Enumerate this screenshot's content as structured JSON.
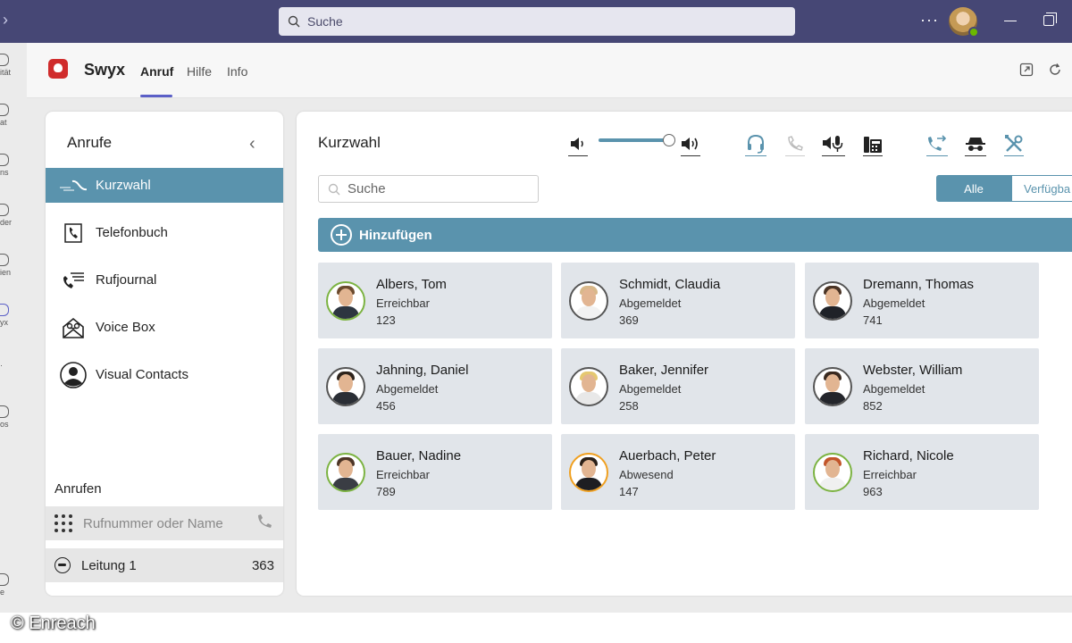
{
  "topbar": {
    "search_placeholder": "Suche",
    "more": "···"
  },
  "rail": {
    "items": [
      {
        "label": "ität"
      },
      {
        "label": "at"
      },
      {
        "label": "ns"
      },
      {
        "label": "der"
      },
      {
        "label": "ien"
      },
      {
        "label": "yx"
      },
      {
        "label": "·"
      },
      {
        "label": "os"
      },
      {
        "label": "e"
      }
    ]
  },
  "app": {
    "name": "Swyx",
    "tabs": [
      {
        "label": "Anruf"
      },
      {
        "label": "Hilfe"
      },
      {
        "label": "Info"
      }
    ]
  },
  "left": {
    "title": "Anrufe",
    "nav": [
      {
        "label": "Kurzwahl",
        "icon": "speed-dial-icon"
      },
      {
        "label": "Telefonbuch",
        "icon": "phonebook-icon"
      },
      {
        "label": "Rufjournal",
        "icon": "call-journal-icon"
      },
      {
        "label": "Voice Box",
        "icon": "voicebox-icon"
      },
      {
        "label": "Visual Contacts",
        "icon": "visual-contacts-icon"
      }
    ],
    "call_section_title": "Anrufen",
    "dial_placeholder": "Rufnummer oder Name",
    "line": {
      "label": "Leitung 1",
      "number": "363"
    }
  },
  "main": {
    "title": "Kurzwahl",
    "search_placeholder": "Suche",
    "filters": [
      {
        "label": "Alle"
      },
      {
        "label": "Verfügba"
      }
    ],
    "add_label": "Hinzufügen",
    "volume_level": 0.9,
    "contacts": [
      {
        "name": "Albers, Tom",
        "status": "Erreichbar",
        "ext": "123"
      },
      {
        "name": "Schmidt, Claudia",
        "status": "Abgemeldet",
        "ext": "369"
      },
      {
        "name": "Dremann, Thomas",
        "status": "Abgemeldet",
        "ext": "741"
      },
      {
        "name": "Jahning, Daniel",
        "status": "Abgemeldet",
        "ext": "456"
      },
      {
        "name": "Baker, Jennifer",
        "status": "Abgemeldet",
        "ext": "258"
      },
      {
        "name": "Webster, William",
        "status": "Abgemeldet",
        "ext": "852"
      },
      {
        "name": "Bauer, Nadine",
        "status": "Erreichbar",
        "ext": "789"
      },
      {
        "name": "Auerbach, Peter",
        "status": "Abwesend",
        "ext": "147"
      },
      {
        "name": "Richard, Nicole",
        "status": "Erreichbar",
        "ext": "963"
      }
    ]
  },
  "colors": {
    "accent": "#5a93ad",
    "teams_bar": "#464775",
    "available": "#7cb342",
    "away": "#f0a020",
    "offline": "#555555"
  },
  "watermark": "© Enreach"
}
